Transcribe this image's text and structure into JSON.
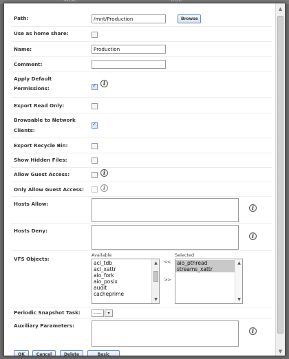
{
  "backdrop": {
    "col1": "false",
    "col2": "true"
  },
  "form": {
    "path": {
      "label": "Path:",
      "value": "/mnt/Production",
      "browse": "Browse"
    },
    "home_share": {
      "label": "Use as home share:",
      "checked": false
    },
    "name": {
      "label": "Name:",
      "value": "Production"
    },
    "comment": {
      "label": "Comment:",
      "value": ""
    },
    "apply_default_permissions": {
      "label_l1": "Apply Default",
      "label_l2": "Permissions:",
      "checked": true
    },
    "export_read_only": {
      "label": "Export Read Only:",
      "checked": false
    },
    "browsable": {
      "label_l1": "Browsable to Network",
      "label_l2": "Clients:",
      "checked": true
    },
    "export_recycle_bin": {
      "label": "Export Recycle Bin:",
      "checked": false
    },
    "show_hidden_files": {
      "label": "Show Hidden Files:",
      "checked": false
    },
    "allow_guest_access": {
      "label": "Allow Guest Access:",
      "checked": false
    },
    "only_allow_guest_access": {
      "label": "Only Allow Guest Access:",
      "checked": false
    },
    "hosts_allow": {
      "label": "Hosts Allow:",
      "value": ""
    },
    "hosts_deny": {
      "label": "Hosts Deny:",
      "value": ""
    },
    "vfs_objects": {
      "label": "VFS Objects:",
      "available_label": "Available",
      "selected_label": "Selected",
      "available": [
        "acl_tdb",
        "acl_xattr",
        "aio_fork",
        "aio_posix",
        "audit",
        "cacheprime"
      ],
      "selected": [
        "aio_pthread",
        "streams_xattr"
      ],
      "move_left": "<<",
      "move_right": ">>"
    },
    "periodic_snapshot_task": {
      "label": "Periodic Snapshot Task:",
      "value": "-----"
    },
    "auxiliary_parameters": {
      "label": "Auxiliary Parameters:",
      "value": ""
    }
  },
  "buttons": {
    "ok": "OK",
    "cancel": "Cancel",
    "delete": "Delete",
    "basic_mode": "Basic Mode"
  },
  "icons": {
    "info": "i"
  },
  "colors": {
    "button_border": "#6e8bb8",
    "selected_item": "#c9c9c9"
  }
}
